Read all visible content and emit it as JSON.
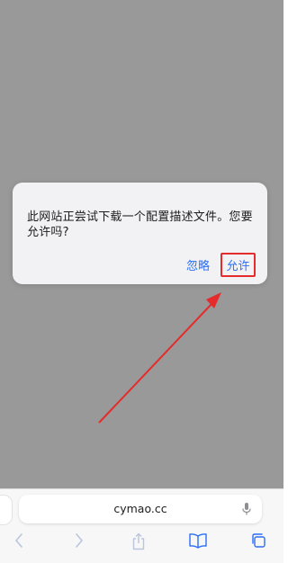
{
  "dialog": {
    "message": "此网站正尝试下载一个配置描述文件。您要允许吗?",
    "ignore_label": "忽略",
    "allow_label": "允许"
  },
  "address_bar": {
    "url": "cymao.cc"
  },
  "toolbar": {
    "items": [
      "back-icon",
      "forward-icon",
      "share-icon",
      "bookmarks-icon",
      "tabs-icon"
    ]
  },
  "colors": {
    "overlay": "#999999",
    "dialog_bg": "#f2f2f4",
    "button_text": "#2b6ef5",
    "highlight": "#e52b2b",
    "toolbar_disabled": "#b9c6dc",
    "toolbar_active": "#2b6ef5"
  }
}
